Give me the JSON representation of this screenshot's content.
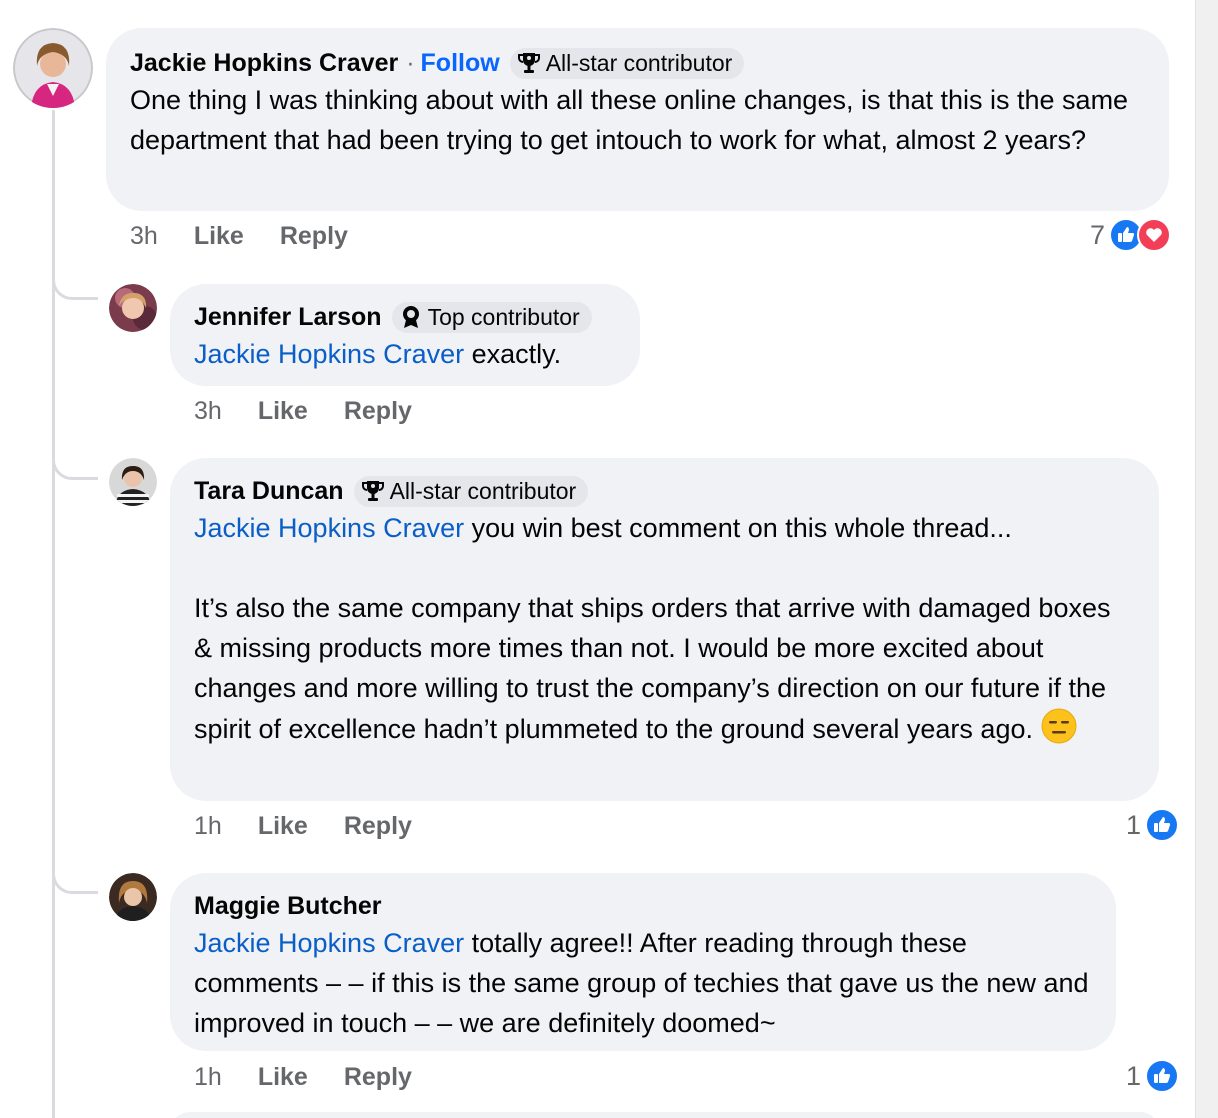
{
  "comments": [
    {
      "author": "Jackie Hopkins Craver",
      "separator": "·",
      "follow_label": "Follow",
      "badge": "All-star contributor",
      "text": "One thing I was thinking about with all these online changes, is that this is the same department that had been trying to get intouch to work for what, almost 2 years?",
      "time": "3h",
      "like_label": "Like",
      "reply_label": "Reply",
      "reaction_count": "7"
    },
    {
      "author": "Jennifer Larson",
      "badge": "Top contributor",
      "mention": "Jackie Hopkins Craver",
      "text": " exactly.",
      "time": "3h",
      "like_label": "Like",
      "reply_label": "Reply"
    },
    {
      "author": "Tara Duncan",
      "badge": "All-star contributor",
      "mention": "Jackie Hopkins Craver",
      "text_line1": " you win best comment on this whole thread...",
      "text_para2": "It’s also the same company that ships orders that arrive with damaged boxes & missing products more times than not. I would be more excited about changes and more willing to trust the company’s direction on our future if the spirit of excellence hadn’t plummeted to the ground several years ago.",
      "time": "1h",
      "like_label": "Like",
      "reply_label": "Reply",
      "reaction_count": "1"
    },
    {
      "author": "Maggie Butcher",
      "mention": "Jackie Hopkins Craver",
      "text": " totally agree!! After reading through these comments – – if this is the same group of techies that gave us the new and improved in touch – – we are definitely doomed~",
      "time": "1h",
      "like_label": "Like",
      "reply_label": "Reply",
      "reaction_count": "1"
    }
  ],
  "colors": {
    "bubble": "#f0f2f5",
    "link": "#0a5ec8",
    "follow": "#0866ff",
    "like": "#1877f2",
    "love": "#f33e58",
    "meta": "#65676b"
  },
  "icons": {
    "trophy": "trophy-icon",
    "top_contributor": "badge-icon",
    "like": "like-icon",
    "love": "love-icon",
    "emoji": "expressionless-face-emoji"
  }
}
